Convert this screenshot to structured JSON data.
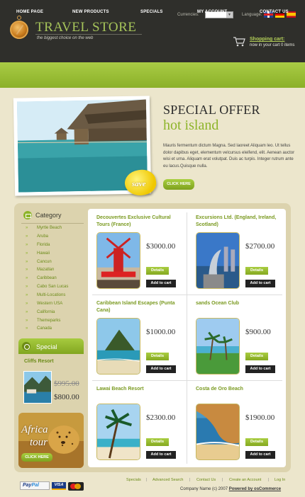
{
  "header": {
    "logo_title": "TRAVEL STORE",
    "logo_subtitle": "the biggest choice on the web",
    "currencies_label": "Currencies:",
    "language_label": "Language:",
    "languages": [
      "flag-uk-icon",
      "flag-de-icon",
      "flag-es-icon"
    ],
    "cart_title": "Shopping cart:",
    "cart_status": "now in your cart 0 items"
  },
  "nav": [
    "HOME PAGE",
    "NEW PRODUCTS",
    "SPECIALS",
    "MY ACCOUNT",
    "CONTACT US"
  ],
  "banner": {
    "title": "SPECIAL OFFER",
    "subtitle": "hot island",
    "text": "Mauris fermentum dictum Magna. Sed laoreet Aliquam leo. Ut tellus dolor dapibus eget, elementum velcursus eleifend, elit. Aenean auctor wisi et urna. Aliquam erat volutpat. Duis ac turpis. Integer rutrum ante eu lacus.Quisque nulla.",
    "badge": "save",
    "button": "CLICK HERE"
  },
  "sidebar": {
    "category_title": "Category",
    "categories": [
      "Myrtle Beach",
      "Aruba",
      "Florida",
      "Hawaii",
      "Cancun",
      "Mazatlan",
      "Caribbean",
      "Cabo San Lucas",
      "Multi-Locations",
      "Western USA",
      "California",
      "Themeparks",
      "Canada"
    ],
    "special_title": "Special",
    "special_name": "Cliffs Resort",
    "special_old_price": "$995.00",
    "special_new_price": "$800.00",
    "promo_line1": "Africa",
    "promo_line2": "tour",
    "promo_button": "CLICK HERE"
  },
  "products": [
    {
      "name": "Decouvertes Exclusive Cultural Tours (France)",
      "price": "$3000.00"
    },
    {
      "name": "Excursions Ltd. (England, Ireland, Scotland)",
      "price": "$2700.00"
    },
    {
      "name": "Caribbean Island Escapes (Punta Cana)",
      "price": "$1000.00"
    },
    {
      "name": "sands Ocean Club",
      "price": "$900.00"
    },
    {
      "name": "Lawai Beach Resort",
      "price": "$2300.00"
    },
    {
      "name": "Costa de Oro Beach",
      "price": "$1900.00"
    }
  ],
  "product_buttons": {
    "details": "Details",
    "add": "Add to cart"
  },
  "footer": {
    "links": [
      "Specials",
      "Advanced Search",
      "Contact Us",
      "Create an Account",
      "Log In"
    ],
    "copyright": "Company Name (c) 2007",
    "powered": "Powered by osCommerce",
    "paypal_a": "Pay",
    "paypal_b": "Pal",
    "visa": "VISA"
  }
}
